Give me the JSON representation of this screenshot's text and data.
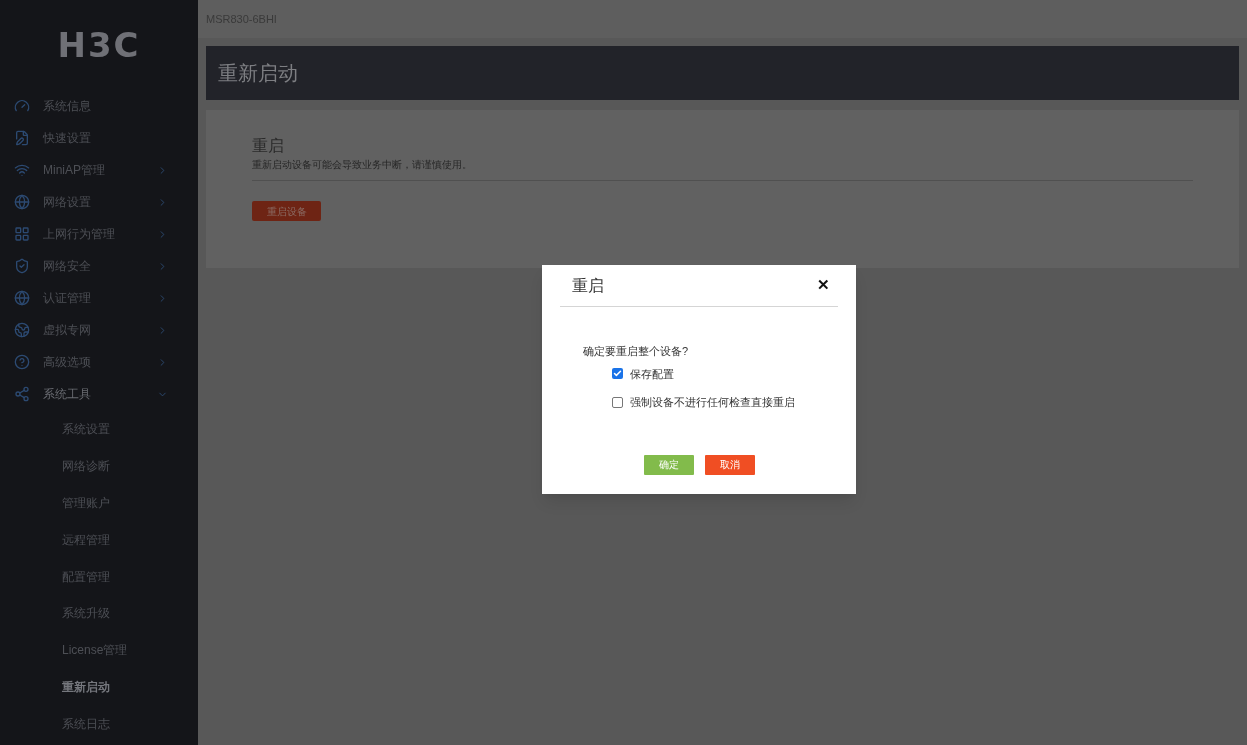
{
  "sidebar": {
    "logo": "H3C",
    "items": [
      {
        "label": "系统信息",
        "kind": "link"
      },
      {
        "label": "快速设置",
        "kind": "link"
      },
      {
        "label": "MiniAP管理",
        "kind": "group",
        "expanded": false
      },
      {
        "label": "网络设置",
        "kind": "group",
        "expanded": false
      },
      {
        "label": "上网行为管理",
        "kind": "group",
        "expanded": false
      },
      {
        "label": "网络安全",
        "kind": "group",
        "expanded": false
      },
      {
        "label": "认证管理",
        "kind": "group",
        "expanded": false
      },
      {
        "label": "虚拟专网",
        "kind": "group",
        "expanded": false
      },
      {
        "label": "高级选项",
        "kind": "group",
        "expanded": false
      },
      {
        "label": "系统工具",
        "kind": "group",
        "expanded": true,
        "children": [
          {
            "label": "系统设置",
            "selected": false
          },
          {
            "label": "网络诊断",
            "selected": false
          },
          {
            "label": "管理账户",
            "selected": false
          },
          {
            "label": "远程管理",
            "selected": false
          },
          {
            "label": "配置管理",
            "selected": false
          },
          {
            "label": "系统升级",
            "selected": false
          },
          {
            "label": "License管理",
            "selected": false
          },
          {
            "label": "重新启动",
            "selected": true
          },
          {
            "label": "系统日志",
            "selected": false
          }
        ]
      }
    ]
  },
  "top_bar": {
    "device": "MSR830-6BHI"
  },
  "page": {
    "title": "重新启动",
    "section": {
      "title": "重启",
      "description": "重新启动设备可能会导致业务中断，请谨慎使用。",
      "button": "重启设备"
    }
  },
  "dialog": {
    "title": "重启",
    "close": "✕",
    "question": "确定要重启整个设备?",
    "options": [
      {
        "label": "保存配置",
        "checked": true
      },
      {
        "label": "强制设备不进行任何检查直接重启",
        "checked": false
      }
    ],
    "buttons": [
      {
        "label": "确定",
        "kind": "confirm"
      },
      {
        "label": "取消",
        "kind": "cancel"
      }
    ]
  }
}
